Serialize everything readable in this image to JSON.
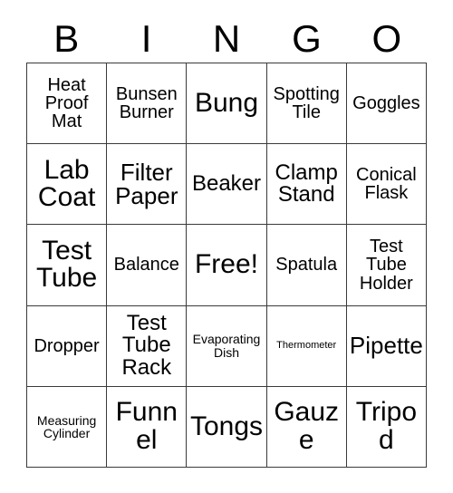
{
  "card": {
    "title": "BINGO",
    "header_letters": [
      "B",
      "I",
      "N",
      "G",
      "O"
    ],
    "free_space_label": "Free!",
    "colors": {
      "border": "#3a3a3a",
      "text": "#000000",
      "background": "#ffffff"
    },
    "rows": [
      [
        {
          "label": "Heat\nProof\nMat",
          "size": "md",
          "free": false
        },
        {
          "label": "Bunsen\nBurner",
          "size": "md",
          "free": false
        },
        {
          "label": "Bung",
          "size": "xxl",
          "free": false
        },
        {
          "label": "Spotting\nTile",
          "size": "md",
          "free": false
        },
        {
          "label": "Goggles",
          "size": "md",
          "free": false
        }
      ],
      [
        {
          "label": "Lab\nCoat",
          "size": "xxl",
          "free": false
        },
        {
          "label": "Filter\nPaper",
          "size": "xl",
          "free": false
        },
        {
          "label": "Beaker",
          "size": "lg",
          "free": false
        },
        {
          "label": "Clamp\nStand",
          "size": "lg",
          "free": false
        },
        {
          "label": "Conical\nFlask",
          "size": "md",
          "free": false
        }
      ],
      [
        {
          "label": "Test\nTube",
          "size": "xxl",
          "free": false
        },
        {
          "label": "Balance",
          "size": "md",
          "free": false
        },
        {
          "label": "Free!",
          "size": "xxl",
          "free": true
        },
        {
          "label": "Spatula",
          "size": "md",
          "free": false
        },
        {
          "label": "Test\nTube\nHolder",
          "size": "md",
          "free": false
        }
      ],
      [
        {
          "label": "Dropper",
          "size": "md",
          "free": false
        },
        {
          "label": "Test\nTube\nRack",
          "size": "lg",
          "free": false
        },
        {
          "label": "Evaporating\nDish",
          "size": "sm",
          "free": false
        },
        {
          "label": "Thermometer",
          "size": "xs",
          "free": false
        },
        {
          "label": "Pipette",
          "size": "xl",
          "free": false
        }
      ],
      [
        {
          "label": "Measuring\nCylinder",
          "size": "sm",
          "free": false
        },
        {
          "label": "Funnel",
          "size": "xxl",
          "free": false
        },
        {
          "label": "Tongs",
          "size": "xxl",
          "free": false
        },
        {
          "label": "Gauze",
          "size": "xxl",
          "free": false
        },
        {
          "label": "Tripod",
          "size": "xxl",
          "free": false
        }
      ]
    ]
  }
}
